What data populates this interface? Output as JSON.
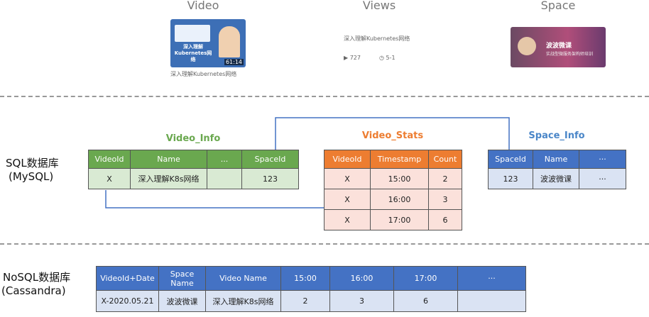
{
  "headers": {
    "video": "Video",
    "views": "Views",
    "space": "Space"
  },
  "video_card": {
    "thumb_title": "深入理解Kubernetes网络",
    "duration": "61:14",
    "caption": "深入理解Kubernetes网络"
  },
  "views_card": {
    "title": "深入理解Kubernetes网络",
    "plays": "727",
    "date": "5-1"
  },
  "space_card": {
    "name": "波波微课",
    "subtitle": "实战型微服务架构师培训"
  },
  "sql": {
    "label_line1": "SQL数据库",
    "label_line2": "(MySQL)",
    "video_info": {
      "title": "Video_Info",
      "columns": [
        "VideoId",
        "Name",
        "...",
        "SpaceId"
      ],
      "rows": [
        [
          "X",
          "深入理解K8s网络",
          "",
          "123"
        ]
      ]
    },
    "video_stats": {
      "title": "Video_Stats",
      "columns": [
        "VideoId",
        "Timestamp",
        "Count"
      ],
      "rows": [
        [
          "X",
          "15:00",
          "2"
        ],
        [
          "X",
          "16:00",
          "3"
        ],
        [
          "X",
          "17:00",
          "6"
        ]
      ]
    },
    "space_info": {
      "title": "Space_Info",
      "columns": [
        "SpaceId",
        "Name",
        "···"
      ],
      "rows": [
        [
          "123",
          "波波微课",
          "···"
        ]
      ]
    }
  },
  "nosql": {
    "label_line1": "NoSQL数据库",
    "label_line2": "(Cassandra)",
    "columns": [
      "VideoId+Date",
      "Space Name",
      "Video Name",
      "15:00",
      "16:00",
      "17:00",
      "···"
    ],
    "rows": [
      [
        "X-2020.05.21",
        "波波微课",
        "深入理解K8s网络",
        "2",
        "3",
        "6",
        ""
      ]
    ]
  },
  "colors": {
    "green": "#6aa84f",
    "orange": "#ed7d31",
    "blue": "#4472c4"
  }
}
